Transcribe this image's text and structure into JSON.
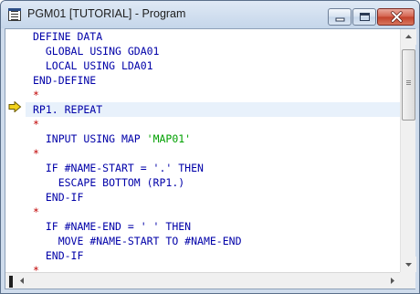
{
  "window": {
    "title": "PGM01 [TUTORIAL] - Program"
  },
  "editor": {
    "current_line_index": 5,
    "lines": [
      {
        "indent": "",
        "text": "DEFINE DATA",
        "kind": "code"
      },
      {
        "indent": "  ",
        "text": "GLOBAL USING GDA01",
        "kind": "code"
      },
      {
        "indent": "  ",
        "text": "LOCAL USING LDA01",
        "kind": "code"
      },
      {
        "indent": "",
        "text": "END-DEFINE",
        "kind": "code"
      },
      {
        "indent": "",
        "text": "*",
        "kind": "comment"
      },
      {
        "indent": "",
        "text": "RP1. REPEAT",
        "kind": "code"
      },
      {
        "indent": "",
        "text": "*",
        "kind": "comment"
      },
      {
        "indent": "  ",
        "text": "INPUT USING MAP ",
        "literal": "'MAP01'",
        "kind": "code"
      },
      {
        "indent": "",
        "text": "*",
        "kind": "comment"
      },
      {
        "indent": "  ",
        "text": "IF #NAME-START = '.' THEN",
        "kind": "code"
      },
      {
        "indent": "    ",
        "text": "ESCAPE BOTTOM (RP1.)",
        "kind": "code"
      },
      {
        "indent": "  ",
        "text": "END-IF",
        "kind": "code"
      },
      {
        "indent": "",
        "text": "*",
        "kind": "comment"
      },
      {
        "indent": "  ",
        "text": "IF #NAME-END = ' ' THEN",
        "kind": "code"
      },
      {
        "indent": "    ",
        "text": "MOVE #NAME-START TO #NAME-END",
        "kind": "code"
      },
      {
        "indent": "  ",
        "text": "END-IF",
        "kind": "code"
      },
      {
        "indent": "",
        "text": "*",
        "kind": "comment"
      }
    ]
  },
  "colors": {
    "code": "#0000a8",
    "literal": "#00a000",
    "comment": "#c00000",
    "current_line_bg": "#e8f1fb",
    "marker": "#f2d21b"
  },
  "icons": {
    "app": "program-document-icon",
    "minimize": "minimize-icon",
    "maximize": "maximize-icon",
    "close": "close-icon",
    "current_line": "current-line-arrow-icon"
  }
}
